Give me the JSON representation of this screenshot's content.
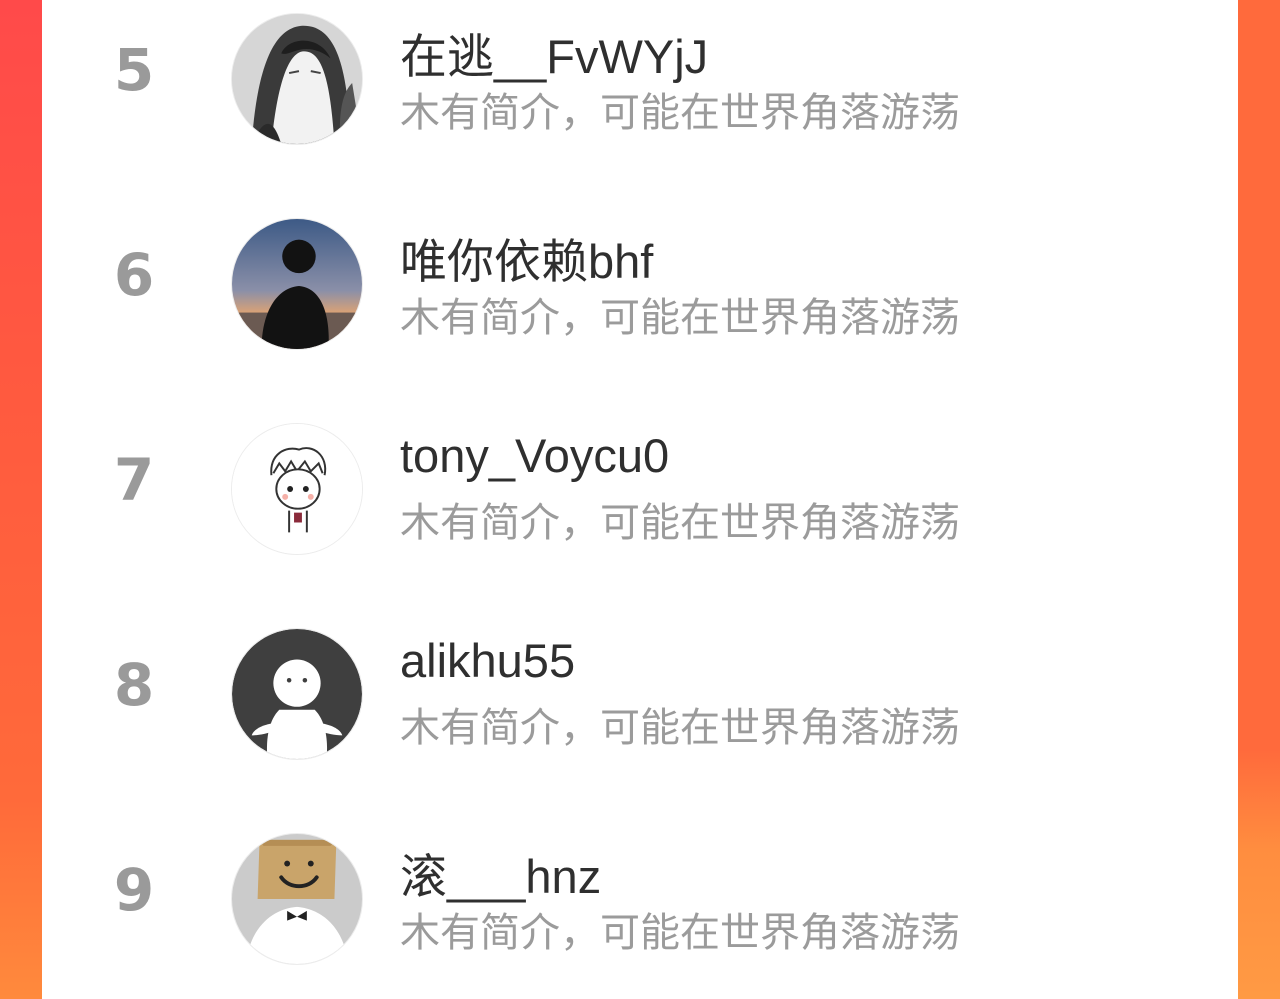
{
  "users": [
    {
      "rank": "5",
      "name": "在逃__FvWYjJ",
      "bio": "木有简介，可能在世界角落游荡",
      "avatar": "ink-sketch-avatar-icon"
    },
    {
      "rank": "6",
      "name": "唯你依赖bhf",
      "bio": "木有简介，可能在世界角落游荡",
      "avatar": "sunset-silhouette-avatar-icon"
    },
    {
      "rank": "7",
      "name": "tony_Voycu0",
      "bio": "木有简介，可能在世界角落游荡",
      "avatar": "cartoon-boy-avatar-icon"
    },
    {
      "rank": "8",
      "name": "alikhu55",
      "bio": "木有简介，可能在世界角落游荡",
      "avatar": "default-ghost-avatar-icon"
    },
    {
      "rank": "9",
      "name": "滚___hnz",
      "bio": "木有简介，可能在世界角落游荡",
      "avatar": "box-head-avatar-icon"
    }
  ],
  "colors": {
    "background_top": "#ff4a4a",
    "background_bottom": "#ff8a3c",
    "rank_text": "#9a9a9a",
    "name_text": "#2f2f2f",
    "bio_text": "#9b9b9b"
  }
}
